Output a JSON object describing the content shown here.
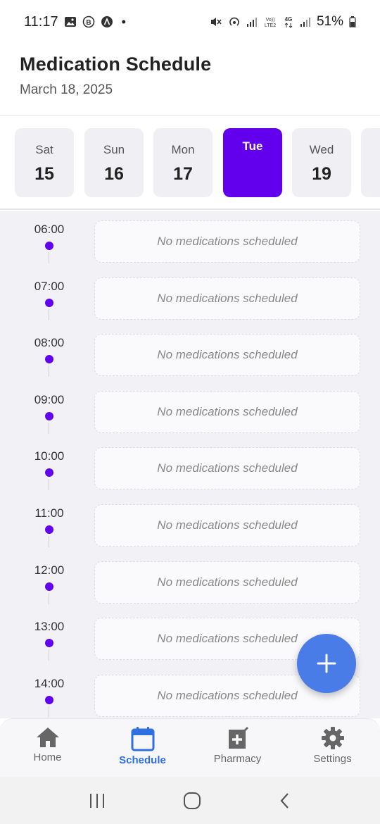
{
  "status_bar": {
    "time": "11:17",
    "dot": "•",
    "battery": "51%",
    "icons_left": [
      "image-icon",
      "b-circle-icon",
      "a-circle-icon"
    ],
    "icons_right": [
      "mute-icon",
      "hotspot-icon",
      "signal-icon",
      "volte-icon",
      "4g-icon",
      "signal-icon",
      "battery-icon"
    ]
  },
  "header": {
    "title": "Medication Schedule",
    "date": "March 18, 2025"
  },
  "days": [
    {
      "name": "Sat",
      "date": "15",
      "selected": false
    },
    {
      "name": "Sun",
      "date": "16",
      "selected": false
    },
    {
      "name": "Mon",
      "date": "17",
      "selected": false
    },
    {
      "name": "Tue",
      "date": "",
      "selected": true
    },
    {
      "name": "Wed",
      "date": "19",
      "selected": false
    },
    {
      "name": "",
      "date": "",
      "selected": false
    }
  ],
  "timeline": {
    "empty_text": "No medications scheduled",
    "slots": [
      "06:00",
      "07:00",
      "08:00",
      "09:00",
      "10:00",
      "11:00",
      "12:00",
      "13:00",
      "14:00"
    ]
  },
  "fab": {
    "icon": "plus-icon"
  },
  "bottom_nav": [
    {
      "label": "Home",
      "icon": "home-icon",
      "active": false
    },
    {
      "label": "Schedule",
      "icon": "calendar-icon",
      "active": true
    },
    {
      "label": "Pharmacy",
      "icon": "pharmacy-icon",
      "active": false
    },
    {
      "label": "Settings",
      "icon": "gear-icon",
      "active": false
    }
  ],
  "system_nav": [
    "recents-icon",
    "home-circle-icon",
    "back-icon"
  ],
  "colors": {
    "accent": "#6200ee",
    "fab": "#4a7ce8",
    "nav_active": "#2f6fe0",
    "timeline_bg": "#f2f2f6"
  }
}
